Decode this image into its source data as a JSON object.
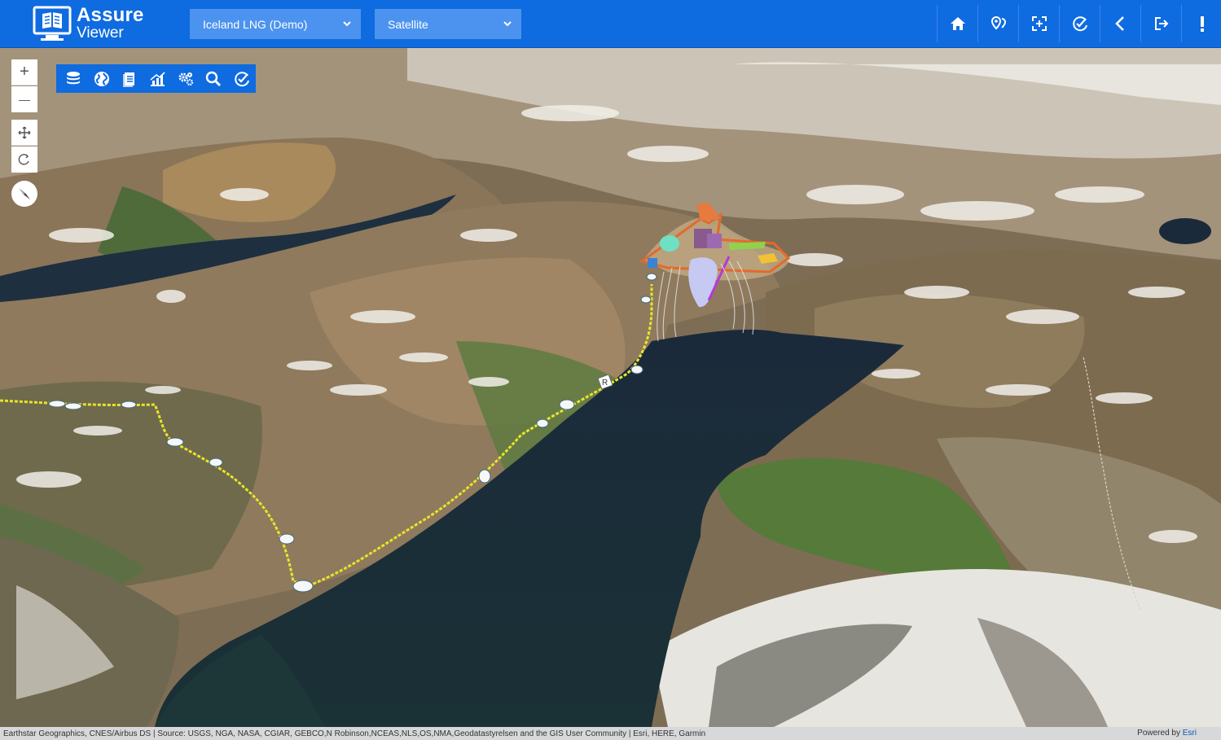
{
  "app": {
    "logo_line1": "Assure",
    "logo_line2": "Viewer"
  },
  "header": {
    "project_select": {
      "value": "Iceland LNG (Demo)"
    },
    "basemap_select": {
      "value": "Satellite"
    },
    "buttons": [
      {
        "icon": "home-icon"
      },
      {
        "icon": "map-pin-icon"
      },
      {
        "icon": "focus-frame-icon"
      },
      {
        "icon": "check-badge-icon"
      },
      {
        "icon": "chevron-left-icon"
      },
      {
        "icon": "logout-icon"
      },
      {
        "icon": "exclamation-icon"
      }
    ]
  },
  "map_controls": {
    "zoom_in": "+",
    "zoom_out": "—",
    "pan": "pan-icon",
    "rotate": "rotate-icon",
    "compass": "compass-icon"
  },
  "toolbar": {
    "tools": [
      "layers-database-icon",
      "globe-icon",
      "document-icon",
      "chart-icon",
      "settings-icon",
      "search-icon",
      "check-circle-icon"
    ]
  },
  "map_labels": {
    "road_marker": "R"
  },
  "attribution": {
    "text": "Earthstar Geographics, CNES/Airbus DS | Source: USGS, NGA, NASA, CGIAR, GEBCO,N Robinson,NCEAS,NLS,OS,NMA,Geodatastyrelsen and the GIS User Community | Esri, HERE, Garmin",
    "powered_prefix": "Powered by ",
    "powered_brand": "Esri"
  },
  "colors": {
    "brand_blue": "#0f6be0",
    "select_blue": "#4c93ef",
    "water": "#15253a",
    "route_line": "#e7e52a"
  }
}
